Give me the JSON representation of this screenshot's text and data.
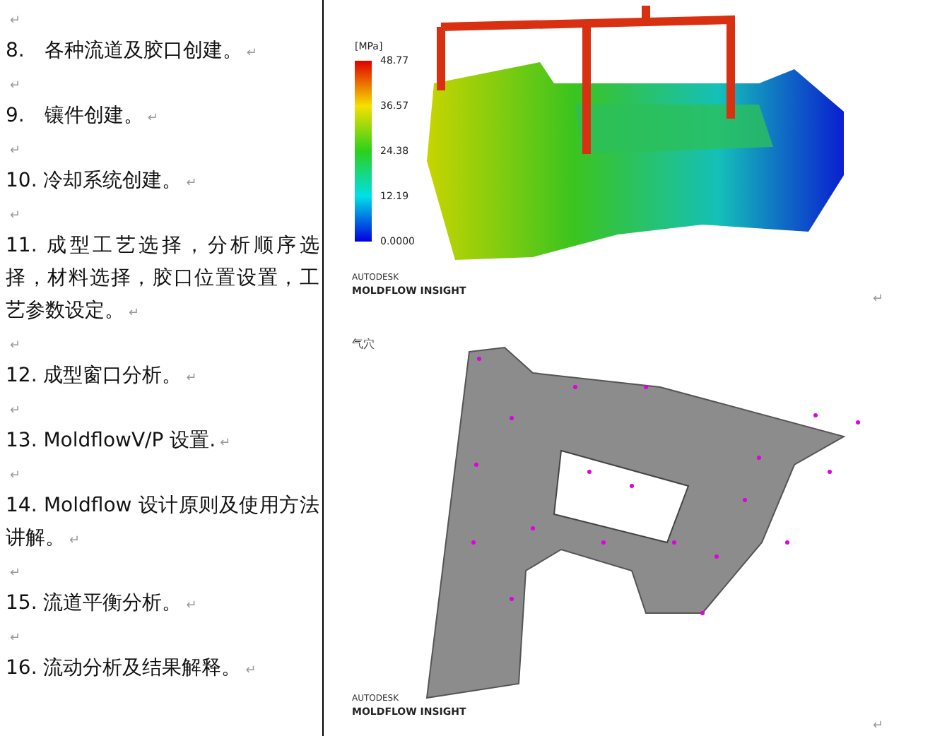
{
  "paragraphs": [
    {
      "kind": "empty",
      "mark": "↵"
    },
    {
      "kind": "text",
      "text": "8.　各种流道及胶口创建。",
      "mark": "↵"
    },
    {
      "kind": "empty",
      "mark": "↵"
    },
    {
      "kind": "text",
      "text": "9.　镶件创建。",
      "mark": "↵"
    },
    {
      "kind": "empty",
      "mark": "↵"
    },
    {
      "kind": "text",
      "text": "10. 冷却系统创建。",
      "mark": "↵"
    },
    {
      "kind": "empty",
      "mark": "↵"
    },
    {
      "kind": "text",
      "text": "11. 成型工艺选择，分析顺序选择，材料选择，胶口位置设置，工艺参数设定。",
      "mark": "↵"
    },
    {
      "kind": "empty",
      "mark": "↵"
    },
    {
      "kind": "text",
      "text": "12. 成型窗口分析。",
      "mark": "↵"
    },
    {
      "kind": "empty",
      "mark": "↵"
    },
    {
      "kind": "text",
      "text": "13. MoldflowV/P 设置.",
      "mark": "↵"
    },
    {
      "kind": "empty",
      "mark": "↵"
    },
    {
      "kind": "text",
      "text": "14. Moldflow  设计原则及使用方法讲解。",
      "mark": "↵"
    },
    {
      "kind": "empty",
      "mark": "↵"
    },
    {
      "kind": "text",
      "text": "15. 流道平衡分析。",
      "mark": "↵"
    },
    {
      "kind": "empty",
      "mark": "↵"
    },
    {
      "kind": "text",
      "text": "16. 流动分析及结果解释。",
      "mark": "↵"
    }
  ],
  "figures": [
    {
      "kind": "stress",
      "unit": "[MPa]",
      "scale": [
        "48.77",
        "36.57",
        "24.38",
        "12.19",
        "0.0000"
      ],
      "brand": "AUTODESK",
      "product": "MOLDFLOW INSIGHT",
      "mark": "↵"
    },
    {
      "kind": "airtrap",
      "caption": "气穴",
      "brand": "AUTODESK",
      "product": "MOLDFLOW INSIGHT",
      "mark": "↵"
    }
  ]
}
